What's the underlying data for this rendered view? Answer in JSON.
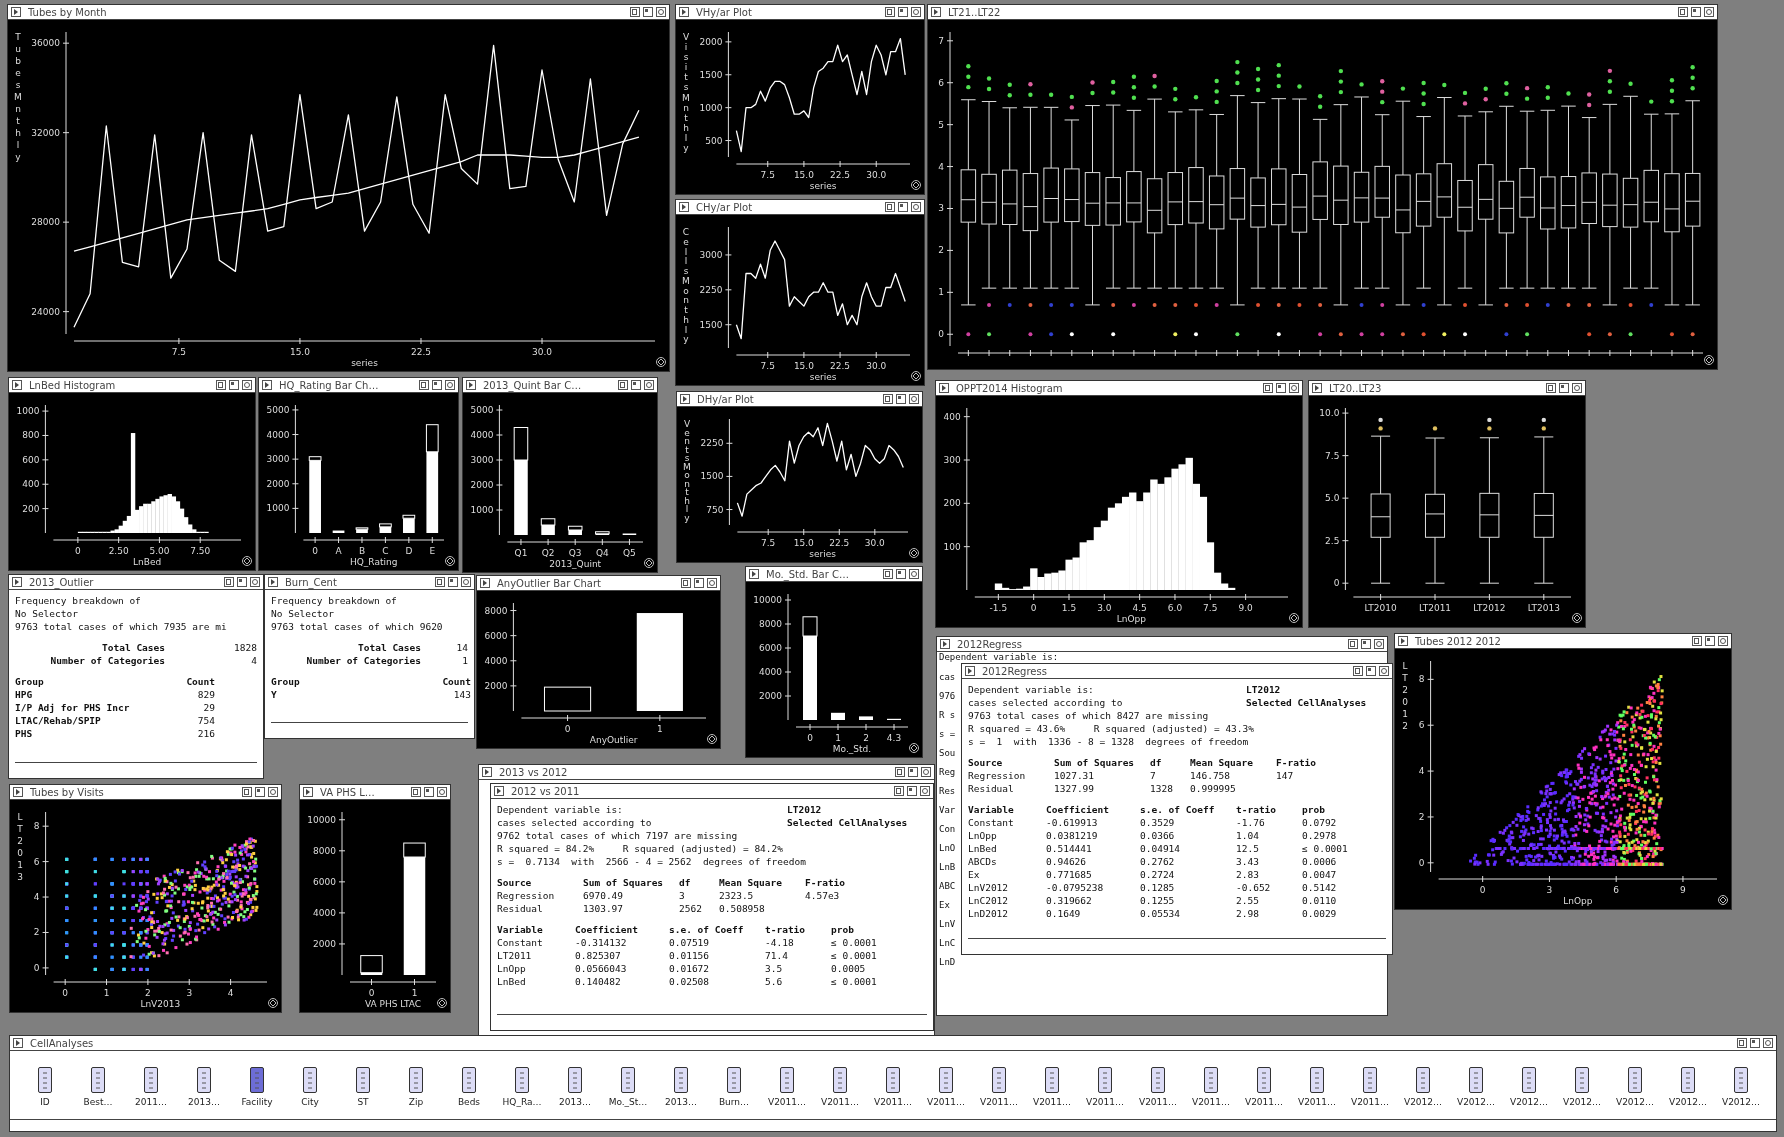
{
  "windows": [
    {
      "title": "Tubes by Month",
      "kind": "chart",
      "chart_data": {
        "type": "line",
        "xlabel": "series",
        "ylabel": "TubesMnthly",
        "x": [
          1,
          2,
          3,
          4,
          5,
          6,
          7,
          8,
          9,
          10,
          11,
          12,
          13,
          14,
          15,
          16,
          17,
          18,
          19,
          20,
          21,
          22,
          23,
          24,
          25,
          26,
          27,
          28,
          29,
          30,
          31,
          32,
          33,
          34,
          35,
          36
        ],
        "xlim": [
          1,
          37
        ],
        "ylim": [
          23000,
          36500
        ],
        "xticks": [
          7.5,
          {
            "value": 15,
            "label": "15.0"
          },
          22.5,
          {
            "value": 30,
            "label": "30.0"
          }
        ],
        "yticks": [
          24000,
          28000,
          32000,
          36000
        ],
        "series": [
          {
            "color": "#ffffff",
            "values": [
              23300,
              24800,
              32300,
              26200,
              26000,
              31900,
              25500,
              26800,
              32000,
              26300,
              25800,
              31900,
              27600,
              27800,
              33700,
              28600,
              28900,
              32800,
              27600,
              28900,
              33600,
              28800,
              27500,
              33700,
              30400,
              29700,
              35900,
              29500,
              29600,
              34800,
              30800,
              28900,
              34400,
              28300,
              31500,
              33000
            ]
          },
          {
            "color": "#ffffff",
            "values": [
              26700,
              26900,
              27100,
              27300,
              27500,
              27700,
              27900,
              28100,
              28200,
              28300,
              28400,
              28500,
              28600,
              28800,
              29000,
              29100,
              29200,
              29300,
              29500,
              29700,
              29900,
              30100,
              30300,
              30500,
              30700,
              31000,
              31000,
              31000,
              30950,
              30900,
              30900,
              31000,
              31200,
              31400,
              31600,
              31800
            ]
          }
        ]
      }
    },
    {
      "title": "VHy/ar Plot",
      "kind": "chart",
      "chart_data": {
        "type": "line",
        "xlabel": "series",
        "ylabel": "VisitsMnthly",
        "x": [
          1,
          2,
          3,
          4,
          5,
          6,
          7,
          8,
          9,
          10,
          11,
          12,
          13,
          14,
          15,
          16,
          17,
          18,
          19,
          20,
          21,
          22,
          23,
          24,
          25,
          26,
          27,
          28,
          29,
          30,
          31,
          32,
          33,
          34,
          35,
          36
        ],
        "xlim": [
          1,
          37
        ],
        "ylim": [
          250,
          2150
        ],
        "xticks": [
          7.5,
          {
            "value": 15,
            "label": "15.0"
          },
          22.5,
          {
            "value": 30,
            "label": "30.0"
          }
        ],
        "yticks": [
          500,
          1000,
          1500,
          2000
        ],
        "series": [
          {
            "color": "#ffffff",
            "values": [
              650,
              330,
              1000,
              1000,
              1050,
              1250,
              1100,
              1300,
              1400,
              1400,
              1350,
              1150,
              900,
              900,
              950,
              850,
              1300,
              1550,
              1600,
              1700,
              1700,
              1950,
              1700,
              1800,
              1500,
              1200,
              1550,
              1200,
              1700,
              1950,
              1800,
              1500,
              1850,
              1850,
              2050,
              1500
            ]
          }
        ]
      }
    },
    {
      "title": "LT21..LT22",
      "kind": "boxplot",
      "yticks": [
        "7",
        "6",
        "5",
        "4",
        "3",
        "2",
        "1",
        "0"
      ]
    },
    {
      "title": "CHy/ar Plot",
      "kind": "chart",
      "chart_data": {
        "type": "line",
        "xlabel": "series",
        "ylabel": "CellsMonthly",
        "x": [
          1,
          2,
          3,
          4,
          5,
          6,
          7,
          8,
          9,
          10,
          11,
          12,
          13,
          14,
          15,
          16,
          17,
          18,
          19,
          20,
          21,
          22,
          23,
          24,
          25,
          26,
          27,
          28,
          29,
          30,
          31,
          32,
          33,
          34,
          35,
          36
        ],
        "xlim": [
          1,
          37
        ],
        "ylim": [
          1000,
          3600
        ],
        "xticks": [
          7.5,
          {
            "value": 15,
            "label": "15.0"
          },
          22.5,
          {
            "value": 30,
            "label": "30.0"
          }
        ],
        "yticks": [
          1500,
          2250,
          3000
        ],
        "series": [
          {
            "color": "#ffffff",
            "values": [
              1500,
              1200,
              2600,
              2600,
              2500,
              2800,
              2500,
              3100,
              3300,
              3100,
              2900,
              1900,
              2100,
              2000,
              1900,
              2100,
              2200,
              2200,
              2400,
              2200,
              2200,
              1700,
              1950,
              1500,
              1700,
              1500,
              2100,
              2400,
              2100,
              1900,
              1900,
              2300,
              2300,
              2600,
              2300,
              2000
            ]
          }
        ]
      }
    },
    {
      "title": "LnBed Histogram",
      "kind": "chart",
      "chart_data": {
        "type": "bar",
        "xlabel": "LnBed",
        "x": [
          0.125,
          0.375,
          0.625,
          0.875,
          1.125,
          1.375,
          1.625,
          1.875,
          2.125,
          2.375,
          2.625,
          2.875,
          3.125,
          3.375,
          3.625,
          3.875,
          4.125,
          4.375,
          4.625,
          4.875,
          5.125,
          5.375,
          5.625,
          5.875,
          6.125,
          6.375,
          6.625,
          6.875,
          7.125,
          7.375,
          7.625,
          7.875
        ],
        "xlim": [
          -1.5,
          10
        ],
        "ylim": [
          0,
          1050
        ],
        "xticks": [
          0,
          {
            "value": 2.5,
            "label": "2.50"
          },
          {
            "value": 5,
            "label": "5.00"
          },
          {
            "value": 7.5,
            "label": "7.50"
          }
        ],
        "yticks": [
          200,
          400,
          600,
          800,
          1000
        ],
        "series": [
          {
            "color": "#ffffff",
            "values": [
              10,
              10,
              10,
              10,
              10,
              10,
              10,
              10,
              20,
              30,
              60,
              100,
              140,
              820,
              190,
              220,
              240,
              240,
              260,
              280,
              300,
              310,
              320,
              300,
              260,
              200,
              130,
              70,
              30,
              10,
              10,
              10
            ]
          }
        ]
      }
    },
    {
      "title": "HQ_Rating Bar Ch…",
      "kind": "chart",
      "chart_data": {
        "type": "bar",
        "xlabel": "HQ_Rating",
        "categories": [
          "0",
          "A",
          "B",
          "C",
          "D",
          "E"
        ],
        "stacked": true,
        "ylim": [
          0,
          5200
        ],
        "yticks": [
          1000,
          2000,
          3000,
          4000,
          5000
        ],
        "series": [
          {
            "color": "#ffffff",
            "values": [
              2950,
              100,
              150,
              250,
              600,
              3300
            ]
          },
          {
            "color": "#000000",
            "values": [
              150,
              0,
              60,
              120,
              120,
              1100
            ]
          }
        ]
      }
    },
    {
      "title": "2013_Quint Bar C…",
      "kind": "chart",
      "chart_data": {
        "type": "bar",
        "xlabel": "2013_Quint",
        "categories": [
          "Q1",
          "Q2",
          "Q3",
          "Q4",
          "Q5"
        ],
        "stacked": true,
        "ylim": [
          0,
          5200
        ],
        "yticks": [
          1000,
          2000,
          3000,
          4000,
          5000
        ],
        "series": [
          {
            "color": "#ffffff",
            "values": [
              3000,
              400,
              200,
              50,
              60
            ]
          },
          {
            "color": "#000000",
            "values": [
              1300,
              250,
              150,
              80,
              0
            ]
          }
        ]
      }
    },
    {
      "title": "DHy/ar Plot",
      "kind": "chart",
      "chart_data": {
        "type": "line",
        "xlabel": "series",
        "ylabel": "VentsMonthly",
        "x": [
          1,
          2,
          3,
          4,
          5,
          6,
          7,
          8,
          9,
          10,
          11,
          12,
          13,
          14,
          15,
          16,
          17,
          18,
          19,
          20,
          21,
          22,
          23,
          24,
          25,
          26,
          27,
          28,
          29,
          30,
          31,
          32,
          33,
          34,
          35,
          36
        ],
        "xlim": [
          1,
          37
        ],
        "ylim": [
          400,
          2800
        ],
        "xticks": [
          7.5,
          {
            "value": 15,
            "label": "15.0"
          },
          22.5,
          {
            "value": 30,
            "label": "30.0"
          }
        ],
        "yticks": [
          750,
          1500,
          2250
        ],
        "series": [
          {
            "color": "#ffffff",
            "values": [
              900,
              600,
              1100,
              1200,
              1300,
              1350,
              1500,
              1650,
              1750,
              1600,
              1400,
              2300,
              1800,
              2200,
              2400,
              2500,
              2400,
              2600,
              2200,
              2700,
              2300,
              1850,
              2300,
              1650,
              2000,
              1500,
              1800,
              2200,
              2100,
              1900,
              1800,
              1900,
              2200,
              2100,
              1950,
              1700
            ]
          }
        ]
      }
    },
    {
      "title": "OPPT2014 Histogram",
      "kind": "chart",
      "chart_data": {
        "type": "bar",
        "xlabel": "LnOpp",
        "x": [
          -1.5,
          -1.2,
          -0.9,
          -0.6,
          -0.3,
          0,
          0.3,
          0.6,
          0.9,
          1.2,
          1.5,
          1.8,
          2.1,
          2.4,
          2.7,
          3,
          3.3,
          3.6,
          3.9,
          4.2,
          4.5,
          4.8,
          5.1,
          5.4,
          5.7,
          6,
          6.3,
          6.6,
          6.9,
          7.2,
          7.5,
          7.8,
          8.1,
          8.4
        ],
        "xlim": [
          -2.5,
          10.8
        ],
        "ylim": [
          0,
          420
        ],
        "xticks": [
          -1.5,
          0,
          1.5,
          {
            "value": 3,
            "label": "3.0"
          },
          4.5,
          {
            "value": 6,
            "label": "6.0"
          },
          7.5,
          {
            "value": 9,
            "label": "9.0"
          }
        ],
        "yticks": [
          100,
          200,
          300,
          400
        ],
        "series": [
          {
            "color": "#ffffff",
            "values": [
              15,
              5,
              2,
              3,
              8,
              50,
              30,
              38,
              40,
              45,
              70,
              75,
              110,
              115,
              145,
              160,
              190,
              200,
              215,
              225,
              205,
              225,
              255,
              245,
              260,
              280,
              290,
              305,
              245,
              215,
              110,
              40,
              15,
              5
            ]
          }
        ]
      }
    },
    {
      "title": "LT20..LT23",
      "kind": "boxplot",
      "yticks": [
        "10.0",
        "7.5",
        "5.0",
        "2.5",
        "0"
      ],
      "categories": [
        "LT2010",
        "LT2011",
        "LT2012",
        "LT2013"
      ]
    },
    {
      "title": "2013_Outlier",
      "kind": "frequency",
      "lines": [
        "Frequency breakdown of",
        "No Selector",
        "9763 total cases of which 7935 are mi"
      ],
      "summary": [
        {
          "label": "Total Cases",
          "value": "1828"
        },
        {
          "label": "Number of Categories",
          "value": "4"
        }
      ],
      "columns": [
        "Group",
        "Count"
      ],
      "rows": [
        [
          "HPG",
          "829"
        ],
        [
          "I/P Adj for PHS Incr",
          "29"
        ],
        [
          "LTAC/Rehab/SPIP",
          "754"
        ],
        [
          "PHS",
          "216"
        ]
      ]
    },
    {
      "title": "Burn_Cent",
      "kind": "frequency",
      "lines": [
        "Frequency breakdown of",
        "No Selector",
        "9763 total cases of which 9620"
      ],
      "summary": [
        {
          "label": "Total Cases",
          "value": "14"
        },
        {
          "label": "Number of Categories",
          "value": "1"
        }
      ],
      "columns": [
        "Group",
        "Count"
      ],
      "rows": [
        [
          "Y",
          "143"
        ]
      ]
    },
    {
      "title": "AnyOutlier Bar Chart",
      "kind": "chart",
      "chart_data": {
        "type": "bar",
        "xlabel": "AnyOutlier",
        "categories": [
          "0",
          "1"
        ],
        "stacked": true,
        "ylim": [
          0,
          8600
        ],
        "yticks": [
          2000,
          4000,
          6000,
          8000
        ],
        "series": [
          {
            "color": "#ffffff",
            "values": [
              0,
              7800
            ]
          },
          {
            "color": "#000000",
            "values": [
              1900,
              0
            ]
          }
        ]
      }
    },
    {
      "title": "Mo._Std. Bar C…",
      "kind": "chart",
      "chart_data": {
        "type": "bar",
        "xlabel": "Mo._Std.",
        "categories": [
          "0",
          "1",
          "2",
          "4.3"
        ],
        "stacked": true,
        "ylim": [
          0,
          10500
        ],
        "yticks": [
          2000,
          4000,
          6000,
          8000,
          10000
        ],
        "series": [
          {
            "color": "#ffffff",
            "values": [
              7000,
              600,
              300,
              100
            ]
          },
          {
            "color": "#000000",
            "values": [
              1600,
              0,
              0,
              0
            ]
          }
        ]
      }
    },
    {
      "title": "2012Regress",
      "kind": "covered",
      "lines": [
        "Dependent variable is:",
        "cas",
        "976",
        "R s",
        "s =",
        "Sou",
        "Reg",
        "Res",
        "Var",
        "Con",
        "LnO",
        "LnB",
        "ABC",
        "Ex",
        "LnV",
        "LnC",
        "LnD"
      ]
    },
    {
      "title": "2012Regress",
      "kind": "regression",
      "header": [
        {
          "label": "Dependent variable is:",
          "value": "LT2012"
        },
        {
          "label": "cases selected according to",
          "value": "Selected CellAnalyses"
        }
      ],
      "lines": [
        "9763 total cases of which 8427 are missing",
        "R squared = 43.6%     R squared (adjusted) = 43.3%",
        "s =  1  with  1336 - 8 = 1328  degrees of freedom"
      ],
      "anova": {
        "columns": [
          "Source",
          "Sum of Squares",
          "df",
          "Mean Square",
          "F-ratio"
        ],
        "rows": [
          [
            "Regression",
            "1027.31",
            "7",
            "146.758",
            "147"
          ],
          [
            "Residual",
            "1327.99",
            "1328",
            "0.999995"
          ]
        ]
      },
      "coefficients": {
        "columns": [
          "Variable",
          "Coefficient",
          "s.e. of Coeff",
          "t-ratio",
          "prob"
        ],
        "rows": [
          [
            "Constant",
            "-0.619913",
            "0.3529",
            "-1.76",
            "0.0792"
          ],
          [
            "LnOpp",
            "0.0381219",
            "0.0366",
            "1.04",
            "0.2978"
          ],
          [
            "LnBed",
            "0.514441",
            "0.04914",
            "12.5",
            "≤ 0.0001"
          ],
          [
            "ABCDs",
            "0.94626",
            "0.2762",
            "3.43",
            "0.0006"
          ],
          [
            "Ex",
            "0.771685",
            "0.2724",
            "2.83",
            "0.0047"
          ],
          [
            "LnV2012",
            "-0.0795238",
            "0.1285",
            "-0.652",
            "0.5142"
          ],
          [
            "LnC2012",
            "0.319662",
            "0.1255",
            "2.55",
            "0.0110"
          ],
          [
            "LnD2012",
            "0.1649",
            "0.05534",
            "2.98",
            "0.0029"
          ]
        ]
      }
    },
    {
      "title": "Tubes 2012 2012",
      "kind": "scatter",
      "xlabel": "LnOpp",
      "ylabel": "LT2012",
      "xticks": [
        "0",
        "3",
        "6",
        "9"
      ],
      "yticks": [
        "8",
        "6",
        "4",
        "2",
        "0"
      ]
    },
    {
      "title": "Tubes by Visits",
      "kind": "scatter",
      "xlabel": "LnV2013",
      "ylabel": "LT2013",
      "xticks": [
        "0",
        "1",
        "2",
        "3",
        "4"
      ],
      "yticks": [
        "8",
        "6",
        "4",
        "2",
        "0"
      ]
    },
    {
      "title": "VA PHS L…",
      "kind": "chart",
      "chart_data": {
        "type": "bar",
        "xlabel": "VA PHS LTAC",
        "categories": [
          "0",
          "1"
        ],
        "stacked": true,
        "ylim": [
          0,
          10500
        ],
        "yticks": [
          2000,
          4000,
          6000,
          8000,
          10000
        ],
        "series": [
          {
            "color": "#ffffff",
            "values": [
              150,
              7600
            ]
          },
          {
            "color": "#000000",
            "values": [
              1100,
              900
            ]
          }
        ]
      }
    },
    {
      "title": "2013 vs 2012",
      "kind": "empty"
    },
    {
      "title": "2012 vs 2011",
      "kind": "regression",
      "header": [
        {
          "label": "Dependent variable is:",
          "value": "LT2012"
        },
        {
          "label": "cases selected according to",
          "value": "Selected CellAnalyses"
        }
      ],
      "lines": [
        "9762 total cases of which 7197 are missing",
        "R squared = 84.2%     R squared (adjusted) = 84.2%",
        "s =  0.7134  with  2566 - 4 = 2562  degrees of freedom"
      ],
      "anova": {
        "columns": [
          "Source",
          "Sum of Squares",
          "df",
          "Mean Square",
          "F-ratio"
        ],
        "rows": [
          [
            "Regression",
            "6970.49",
            "3",
            "2323.5",
            "4.57e3"
          ],
          [
            "Residual",
            "1303.97",
            "2562",
            "0.508958"
          ]
        ]
      },
      "coefficients": {
        "columns": [
          "Variable",
          "Coefficient",
          "s.e. of Coeff",
          "t-ratio",
          "prob"
        ],
        "rows": [
          [
            "Constant",
            "-0.314132",
            "0.07519",
            "-4.18",
            "≤ 0.0001"
          ],
          [
            "LT2011",
            "0.825307",
            "0.01156",
            "71.4",
            "≤ 0.0001"
          ],
          [
            "LnOpp",
            "0.0566043",
            "0.01672",
            "3.5",
            "0.0005"
          ],
          [
            "LnBed",
            "0.140482",
            "0.02508",
            "5.6",
            "≤ 0.0001"
          ]
        ]
      }
    },
    {
      "title": "CellAnalyses",
      "kind": "icons",
      "variables": [
        {
          "name": "ID",
          "selected": false
        },
        {
          "name": "Best…",
          "selected": false
        },
        {
          "name": "2011…",
          "selected": false
        },
        {
          "name": "2013…",
          "selected": false
        },
        {
          "name": "Facility",
          "selected": true
        },
        {
          "name": "City",
          "selected": false
        },
        {
          "name": "ST",
          "selected": false
        },
        {
          "name": "Zip",
          "selected": false
        },
        {
          "name": "Beds",
          "selected": false
        },
        {
          "name": "HQ_Ra…",
          "selected": false
        },
        {
          "name": "2013…",
          "selected": false
        },
        {
          "name": "Mo._St…",
          "selected": false
        },
        {
          "name": "2013…",
          "selected": false
        },
        {
          "name": "Burn…",
          "selected": false
        },
        {
          "name": "V2011…",
          "selected": false
        },
        {
          "name": "V2011…",
          "selected": false
        },
        {
          "name": "V2011…",
          "selected": false
        },
        {
          "name": "V2011…",
          "selected": false
        },
        {
          "name": "V2011…",
          "selected": false
        },
        {
          "name": "V2011…",
          "selected": false
        },
        {
          "name": "V2011…",
          "selected": false
        },
        {
          "name": "V2011…",
          "selected": false
        },
        {
          "name": "V2011…",
          "selected": false
        },
        {
          "name": "V2011…",
          "selected": false
        },
        {
          "name": "V2011…",
          "selected": false
        },
        {
          "name": "V2011…",
          "selected": false
        },
        {
          "name": "V2012…",
          "selected": false
        },
        {
          "name": "V2012…",
          "selected": false
        },
        {
          "name": "V2012…",
          "selected": false
        },
        {
          "name": "V2012…",
          "selected": false
        },
        {
          "name": "V2012…",
          "selected": false
        },
        {
          "name": "V2012…",
          "selected": false
        },
        {
          "name": "V2012…",
          "selected": false
        }
      ]
    }
  ]
}
